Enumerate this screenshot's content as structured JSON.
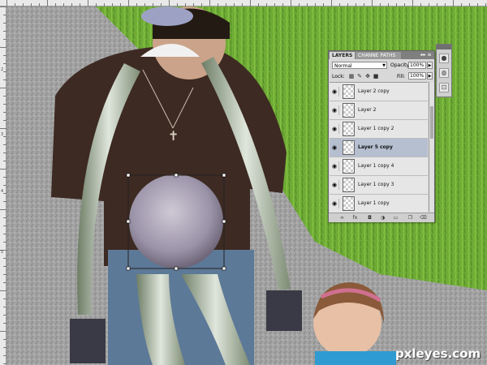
{
  "ruler": {
    "top_numbers": [
      "",
      "",
      "",
      "",
      "",
      "",
      "",
      "",
      "",
      "",
      "",
      ""
    ],
    "left_numbers": [
      "2",
      "3",
      "4",
      "5"
    ]
  },
  "layers_panel": {
    "tabs": [
      {
        "label": "LAYERS"
      },
      {
        "label": "CHANNE PATHS"
      }
    ],
    "menu_label": "▸▸ ≡",
    "blend_mode": "Normal",
    "opacity_label": "Opacity:",
    "opacity_value": "100%",
    "lock_label": "Lock:",
    "lock_icons": [
      "transparency-lock-icon",
      "brush-lock-icon",
      "move-lock-icon",
      "padlock-icon"
    ],
    "fill_label": "Fill:",
    "fill_value": "100%",
    "layers": [
      {
        "name": "Layer 2 copy",
        "visible": true,
        "selected": false
      },
      {
        "name": "Layer 2",
        "visible": true,
        "selected": false
      },
      {
        "name": "Layer 1 copy 2",
        "visible": true,
        "selected": false
      },
      {
        "name": "Layer 5 copy",
        "visible": true,
        "selected": true
      },
      {
        "name": "Layer 1 copy 4",
        "visible": true,
        "selected": false
      },
      {
        "name": "Layer 1 copy 3",
        "visible": true,
        "selected": false
      },
      {
        "name": "Layer 1 copy",
        "visible": true,
        "selected": false
      }
    ],
    "footer_icons": [
      "link-icon",
      "fx-icon",
      "mask-icon",
      "adjustment-icon",
      "folder-icon",
      "new-layer-icon",
      "trash-icon"
    ]
  },
  "side_strip": {
    "buttons": [
      "sphere-icon",
      "drop-icon",
      "transform-icon"
    ]
  },
  "watermark": {
    "text": "pxleyes.com"
  },
  "colors": {
    "selection_row": "#b5bfd0",
    "grass": "#6aa534",
    "gravel": "#9a9a9a",
    "shirt": "#3d2a22",
    "jeans": "#5d7998"
  }
}
